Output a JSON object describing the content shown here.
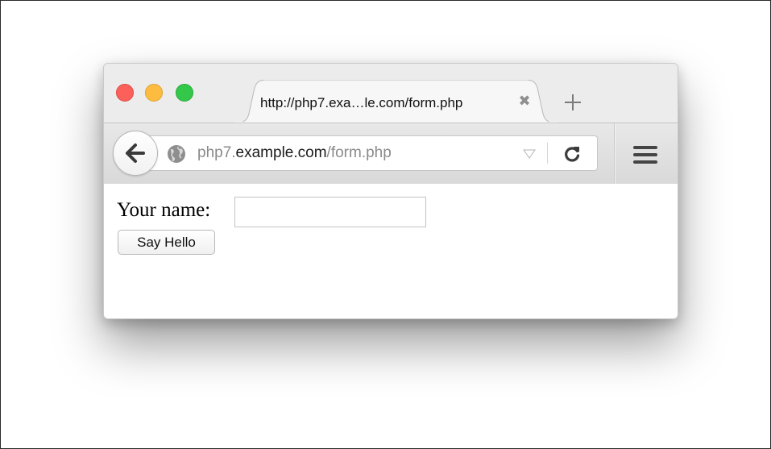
{
  "browser": {
    "tab": {
      "title": "http://php7.exa…le.com/form.php",
      "close_glyph": "✖"
    },
    "address_bar": {
      "url_prefix": "php7.",
      "url_host": "example.com",
      "url_path": "/form.php"
    },
    "icons": {
      "back": "back-arrow-icon",
      "site": "globe-icon",
      "dropdown": "dropdown-triangle-icon",
      "reload": "reload-icon",
      "menu": "hamburger-menu-icon",
      "new_tab": "plus-icon"
    }
  },
  "page": {
    "form": {
      "name_label": "Your name:",
      "name_value": "",
      "submit_label": "Say Hello"
    }
  },
  "colors": {
    "close_light": "#fc605b",
    "minimize_light": "#fdbc40",
    "maximize_light": "#34c84a"
  }
}
